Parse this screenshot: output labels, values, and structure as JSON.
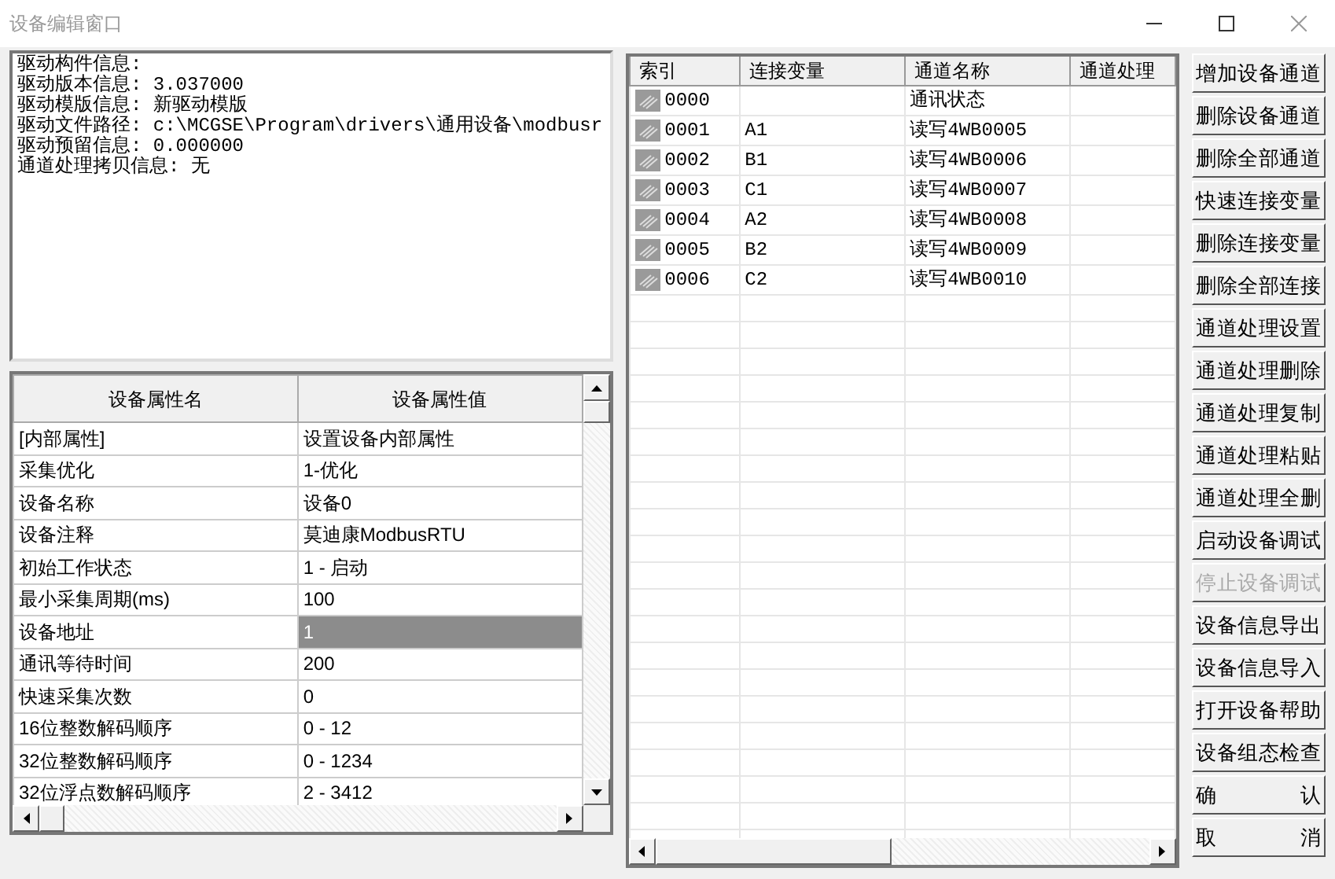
{
  "window": {
    "title": "设备编辑窗口"
  },
  "driver_info": [
    "驱动构件信息:",
    "驱动版本信息: 3.037000",
    "驱动模版信息: 新驱动模版",
    "驱动文件路径: c:\\MCGSE\\Program\\drivers\\通用设备\\modbusr",
    "驱动预留信息: 0.000000",
    "通道处理拷贝信息: 无"
  ],
  "properties": {
    "columns": [
      "设备属性名",
      "设备属性值"
    ],
    "rows": [
      {
        "name": "[内部属性]",
        "value": "设置设备内部属性",
        "selected": false
      },
      {
        "name": "采集优化",
        "value": "1-优化",
        "selected": false
      },
      {
        "name": "设备名称",
        "value": "设备0",
        "selected": false
      },
      {
        "name": "设备注释",
        "value": "莫迪康ModbusRTU",
        "selected": false
      },
      {
        "name": "初始工作状态",
        "value": "1 - 启动",
        "selected": false
      },
      {
        "name": "最小采集周期(ms)",
        "value": "100",
        "selected": false
      },
      {
        "name": "设备地址",
        "value": "1",
        "selected": true
      },
      {
        "name": "通讯等待时间",
        "value": "200",
        "selected": false
      },
      {
        "name": "快速采集次数",
        "value": "0",
        "selected": false
      },
      {
        "name": "16位整数解码顺序",
        "value": "0 - 12",
        "selected": false
      },
      {
        "name": "32位整数解码顺序",
        "value": "0 - 1234",
        "selected": false
      },
      {
        "name": "32位浮点数解码顺序",
        "value": "2 - 3412",
        "selected": false
      }
    ]
  },
  "channels": {
    "columns": [
      "索引",
      "连接变量",
      "通道名称",
      "通道处理"
    ],
    "rows": [
      {
        "index": "0000",
        "variable": "",
        "name": "通讯状态"
      },
      {
        "index": "0001",
        "variable": "A1",
        "name": "读写4WB0005"
      },
      {
        "index": "0002",
        "variable": "B1",
        "name": "读写4WB0006"
      },
      {
        "index": "0003",
        "variable": "C1",
        "name": "读写4WB0007"
      },
      {
        "index": "0004",
        "variable": "A2",
        "name": "读写4WB0008"
      },
      {
        "index": "0005",
        "variable": "B2",
        "name": "读写4WB0009"
      },
      {
        "index": "0006",
        "variable": "C2",
        "name": "读写4WB0010"
      }
    ]
  },
  "buttons": [
    {
      "label": "增加设备通道",
      "disabled": false
    },
    {
      "label": "删除设备通道",
      "disabled": false
    },
    {
      "label": "删除全部通道",
      "disabled": false
    },
    {
      "label": "快速连接变量",
      "disabled": false
    },
    {
      "label": "删除连接变量",
      "disabled": false
    },
    {
      "label": "删除全部连接",
      "disabled": false
    },
    {
      "label": "通道处理设置",
      "disabled": false
    },
    {
      "label": "通道处理删除",
      "disabled": false
    },
    {
      "label": "通道处理复制",
      "disabled": false
    },
    {
      "label": "通道处理粘贴",
      "disabled": false
    },
    {
      "label": "通道处理全删",
      "disabled": false
    },
    {
      "label": "启动设备调试",
      "disabled": false
    },
    {
      "label": "停止设备调试",
      "disabled": true
    },
    {
      "label": "设备信息导出",
      "disabled": false
    },
    {
      "label": "设备信息导入",
      "disabled": false
    },
    {
      "label": "打开设备帮助",
      "disabled": false
    },
    {
      "label": "设备组态检查",
      "disabled": false
    },
    {
      "label": "确 认",
      "disabled": false
    },
    {
      "label": "取 消",
      "disabled": false
    }
  ]
}
